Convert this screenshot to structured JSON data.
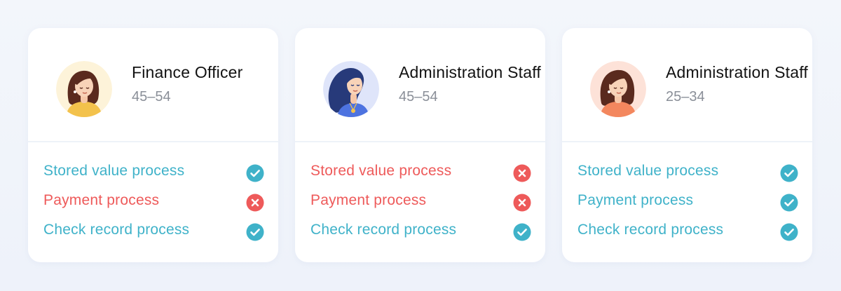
{
  "colors": {
    "ok": "#3fb2c9",
    "fail": "#ee5a5a",
    "text": "#121212",
    "muted": "#8a8f98",
    "background": "#f3f6fb",
    "card": "#ffffff"
  },
  "cards": [
    {
      "role": "Finance Officer",
      "age": "45–54",
      "avatar": {
        "icon": "woman-avatar-icon",
        "background": "#fdf3d9",
        "shirt": "#f3c24c",
        "hair": "#5a2a1e"
      },
      "processes": [
        {
          "label": "Stored value process",
          "status": "ok",
          "icon": "check-circle-icon"
        },
        {
          "label": "Payment process",
          "status": "fail",
          "icon": "x-circle-icon"
        },
        {
          "label": "Check record process",
          "status": "ok",
          "icon": "check-circle-icon"
        }
      ]
    },
    {
      "role": "Administration Staff",
      "age": "45–54",
      "avatar": {
        "icon": "woman-avatar-icon",
        "background": "#dfe5fa",
        "shirt": "#4d73e0",
        "hair": "#273a7a"
      },
      "processes": [
        {
          "label": "Stored value process",
          "status": "fail",
          "icon": "x-circle-icon"
        },
        {
          "label": "Payment process",
          "status": "fail",
          "icon": "x-circle-icon"
        },
        {
          "label": "Check record process",
          "status": "ok",
          "icon": "check-circle-icon"
        }
      ]
    },
    {
      "role": "Administration Staff",
      "age": "25–34",
      "avatar": {
        "icon": "woman-avatar-icon",
        "background": "#fde2d8",
        "shirt": "#f3875e",
        "hair": "#5a2a1e"
      },
      "processes": [
        {
          "label": "Stored value process",
          "status": "ok",
          "icon": "check-circle-icon"
        },
        {
          "label": "Payment process",
          "status": "ok",
          "icon": "check-circle-icon"
        },
        {
          "label": "Check record process",
          "status": "ok",
          "icon": "check-circle-icon"
        }
      ]
    }
  ]
}
